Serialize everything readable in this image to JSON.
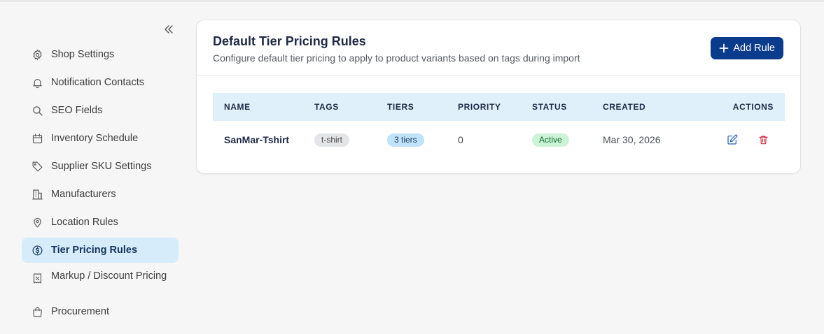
{
  "sidebar": {
    "items": [
      {
        "label": "Shop Settings",
        "icon": "gear-icon"
      },
      {
        "label": "Notification Contacts",
        "icon": "bell-icon"
      },
      {
        "label": "SEO Fields",
        "icon": "search-icon"
      },
      {
        "label": "Inventory Schedule",
        "icon": "calendar-icon"
      },
      {
        "label": "Supplier SKU Settings",
        "icon": "tag-icon"
      },
      {
        "label": "Manufacturers",
        "icon": "building-icon"
      },
      {
        "label": "Location Rules",
        "icon": "map-pin-icon"
      },
      {
        "label": "Tier Pricing Rules",
        "icon": "dollar-circle-icon",
        "active": true
      },
      {
        "label": "Markup / Discount Pricing",
        "icon": "receipt-percent-icon"
      },
      {
        "label": "Procurement",
        "icon": "shopping-bag-icon"
      }
    ]
  },
  "card": {
    "title": "Default Tier Pricing Rules",
    "subtitle": "Configure default tier pricing to apply to product variants based on tags during import",
    "add_button_label": "Add Rule"
  },
  "table": {
    "headers": {
      "name": "NAME",
      "tags": "TAGS",
      "tiers": "TIERS",
      "priority": "PRIORITY",
      "status": "STATUS",
      "created": "CREATED",
      "actions": "ACTIONS"
    },
    "rows": [
      {
        "name": "SanMar-Tshirt",
        "tag": "t-shirt",
        "tiers": "3 tiers",
        "priority": "0",
        "status": "Active",
        "created": "Mar 30, 2026"
      }
    ]
  },
  "colors": {
    "accent": "#0b3b8c",
    "active_nav_bg": "#d6ecfa",
    "table_header_bg": "#dff0fb",
    "status_active_bg": "#cdf3d6",
    "delete_red": "#d9263a",
    "edit_blue": "#1f5fbf"
  }
}
